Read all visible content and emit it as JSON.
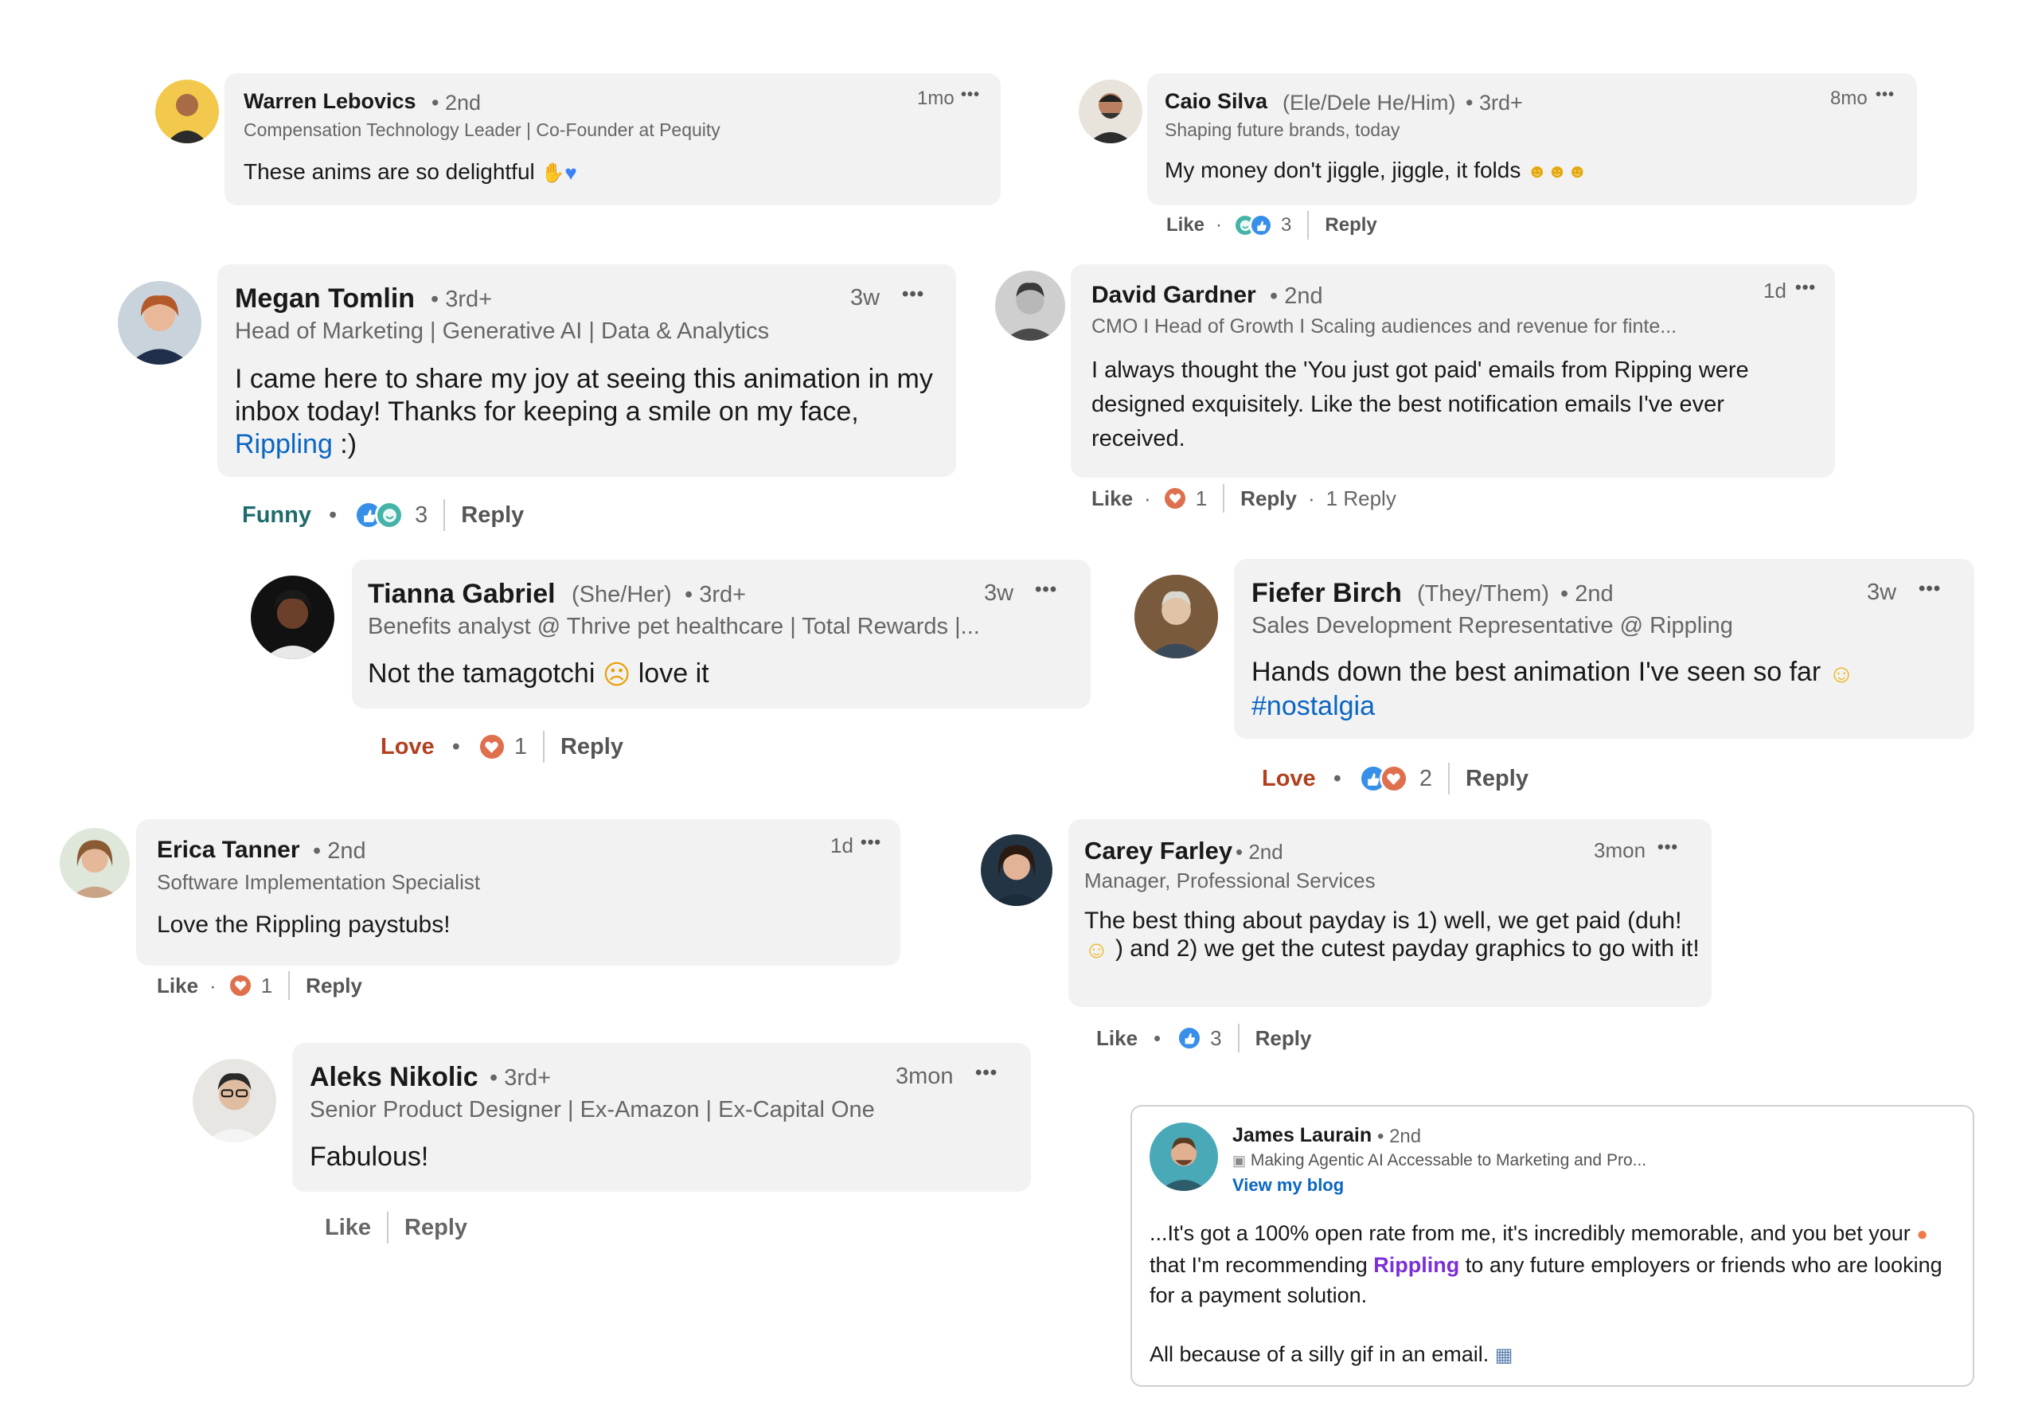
{
  "comments": [
    {
      "name": "Warren Lebovics",
      "degree": "• 2nd",
      "headline": "Compensation Technology Leader | Co-Founder at Pequity",
      "time": "1mo",
      "more": "•••",
      "text": "These anims are so delightful"
    },
    {
      "name": "Caio Silva",
      "pronouns": "(Ele/Dele He/Him)",
      "degree": "• 3rd+",
      "headline": "Shaping future brands, today",
      "time": "8mo",
      "more": "•••",
      "text": "My money don't jiggle, jiggle, it folds",
      "actions": {
        "like": "Like",
        "dot": "·",
        "count": "3",
        "reply": "Reply"
      }
    },
    {
      "name": "Megan Tomlin",
      "degree": "• 3rd+",
      "headline": "Head of Marketing | Generative AI | Data & Analytics",
      "time": "3w",
      "more": "•••",
      "text": "I came here to share my joy at seeing this animation in my inbox today! Thanks for keeping a smile on my face,",
      "link": "Rippling",
      "text_after": " :)",
      "actions": {
        "reaction": "Funny",
        "dot": "•",
        "count": "3",
        "reply": "Reply"
      }
    },
    {
      "name": "David Gardner",
      "degree": "• 2nd",
      "headline": "CMO I Head of Growth I Scaling audiences and revenue for finte...",
      "time": "1d",
      "more": "•••",
      "text": "I always thought the 'You just got paid' emails from Ripping were designed exquisitely. Like the best notification emails I've ever received.",
      "actions": {
        "like": "Like",
        "dot": "·",
        "count": "1",
        "reply": "Reply",
        "dot2": "·",
        "replies": "1 Reply"
      }
    },
    {
      "name": "Tianna Gabriel",
      "pronouns": "(She/Her)",
      "degree": "• 3rd+",
      "headline": "Benefits analyst @ Thrive pet healthcare | Total Rewards |...",
      "time": "3w",
      "more": "•••",
      "text_before": "Not the tamagotchi",
      "text_after": "love it",
      "actions": {
        "reaction": "Love",
        "dot": "•",
        "count": "1",
        "reply": "Reply"
      }
    },
    {
      "name": "Fiefer Birch",
      "pronouns": "(They/Them)",
      "degree": "• 2nd",
      "headline": "Sales Development Representative @ Rippling",
      "time": "3w",
      "more": "•••",
      "text": "Hands down the best animation I've seen so far",
      "hashtag": "#nostalgia",
      "actions": {
        "reaction": "Love",
        "dot": "•",
        "count": "2",
        "reply": "Reply"
      }
    },
    {
      "name": "Erica Tanner",
      "degree": "• 2nd",
      "headline": "Software Implementation Specialist",
      "time": "1d",
      "more": "•••",
      "text": "Love the Rippling paystubs!",
      "actions": {
        "like": "Like",
        "dot": "·",
        "count": "1",
        "reply": "Reply"
      }
    },
    {
      "name": "Carey Farley",
      "degree": "• 2nd",
      "headline": "Manager, Professional Services",
      "time": "3mon",
      "more": "•••",
      "text_before": "The best thing about payday is 1) well, we get paid (duh!",
      "text_after": ") and 2) we get the cutest payday graphics to go with it!",
      "actions": {
        "like": "Like",
        "dot": "•",
        "count": "3",
        "reply": "Reply"
      }
    },
    {
      "name": "Aleks Nikolic",
      "degree": "• 3rd+",
      "headline": "Senior Product Designer | Ex-Amazon | Ex-Capital One",
      "time": "3mon",
      "more": "•••",
      "text": "Fabulous!",
      "actions": {
        "like": "Like",
        "reply": "Reply"
      }
    }
  ],
  "card": {
    "name": "James Laurain",
    "degree": "• 2nd",
    "headline": "Making Agentic AI Accessable to Marketing and Pro...",
    "cta": "View my blog",
    "para1_before": "...It's got a 100% open rate from me, it's incredibly memorable, and you bet your",
    "para1_mid": "that I'm recommending",
    "para1_link": "Rippling",
    "para1_after": "to any future employers or friends who are looking for a payment solution.",
    "para2": "All because of a silly gif in an email."
  },
  "colors": {
    "bubble": "#f2f2f2",
    "link_blue": "#0a66c2",
    "link_purple": "#7b2fd6",
    "like": "#378fe9",
    "love": "#df704d",
    "funny": "#44b4a8",
    "funny_label": "#1f6b6b",
    "love_label": "#b24020"
  }
}
